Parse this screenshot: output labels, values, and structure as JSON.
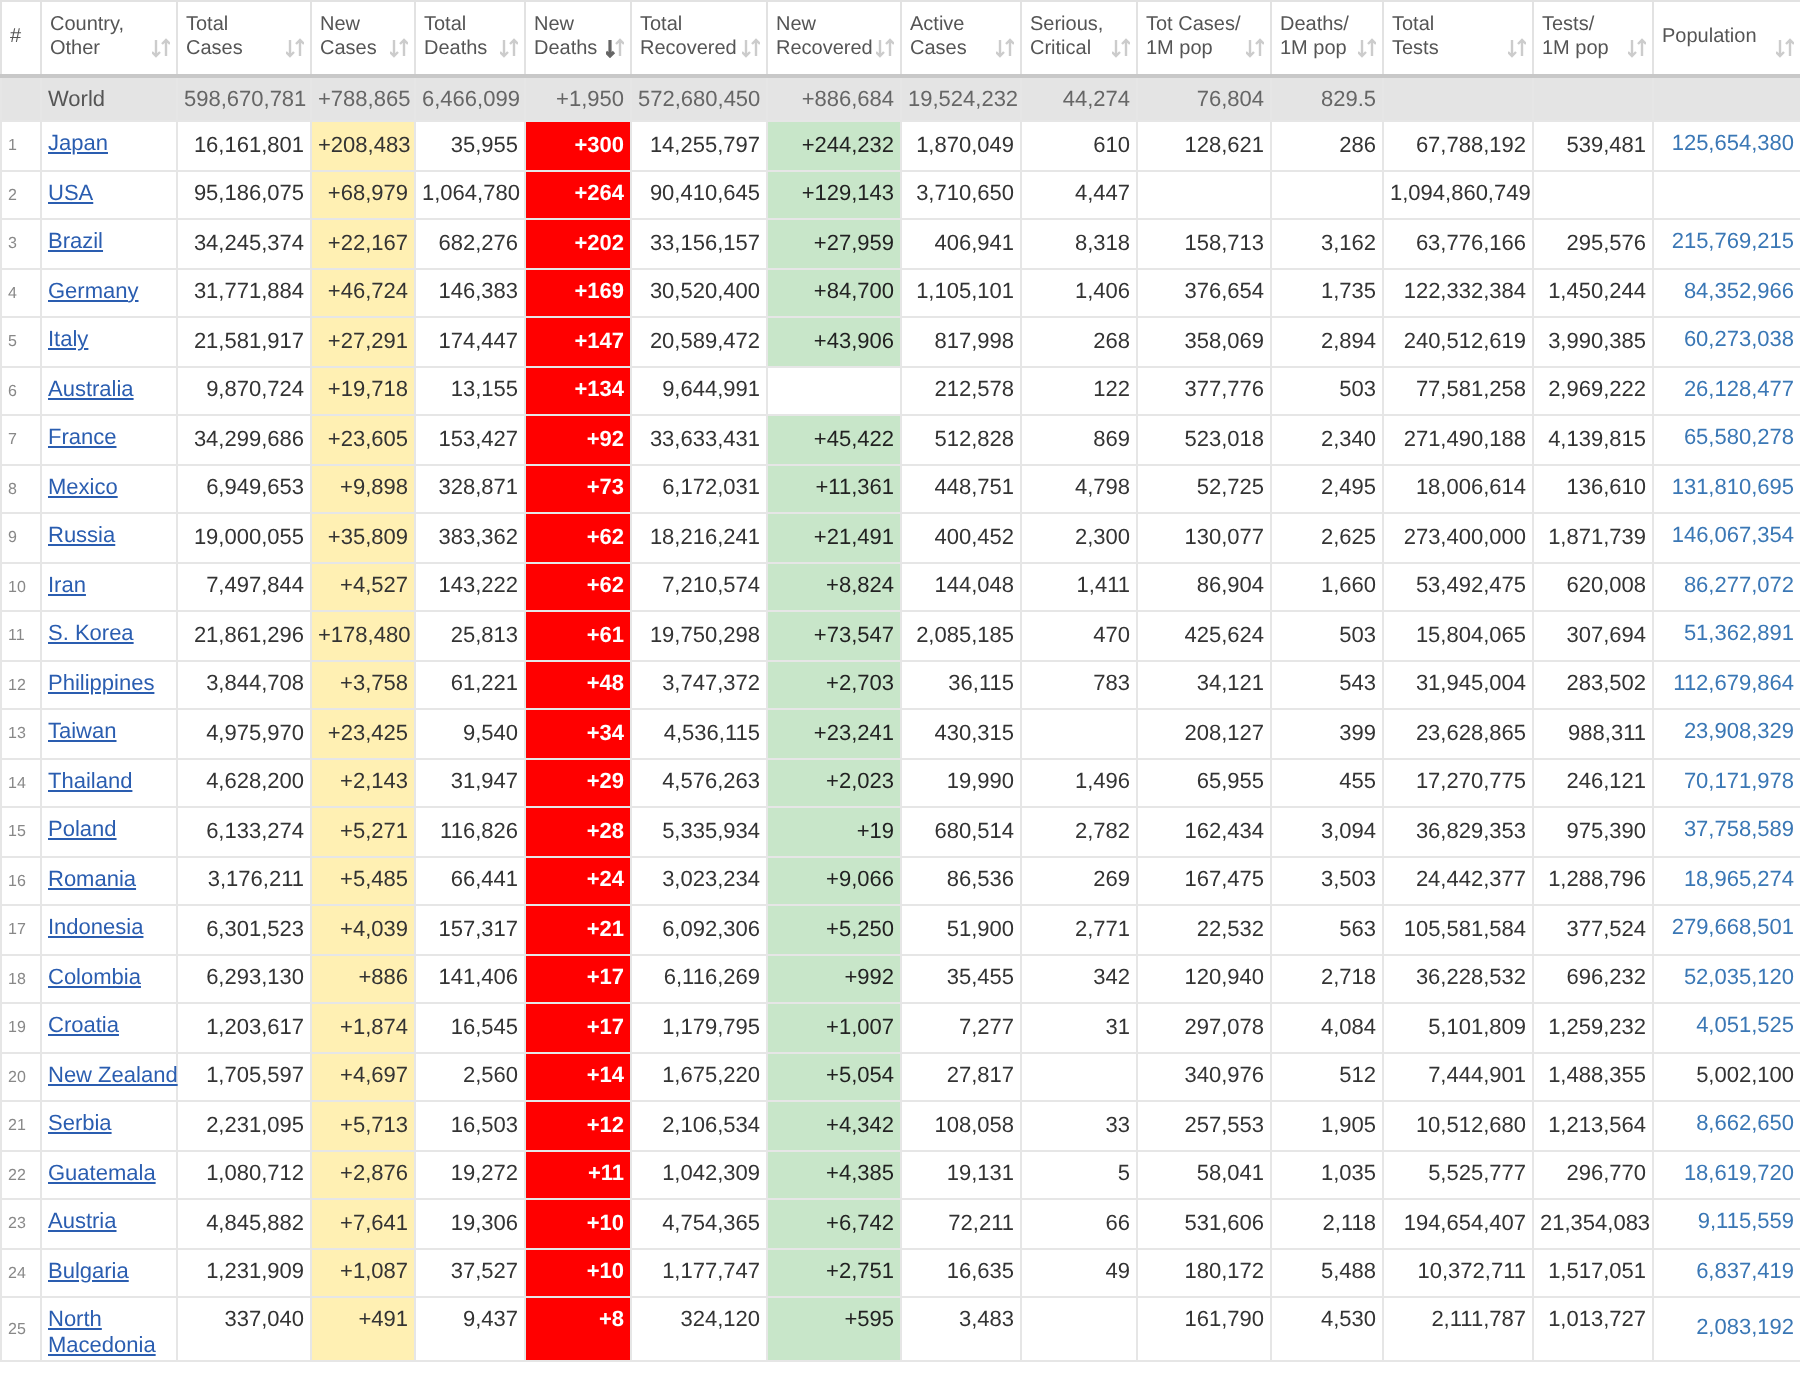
{
  "table": {
    "columns": [
      {
        "label": "#",
        "kind": "rank",
        "sortable": false
      },
      {
        "label": "Country,\nOther",
        "kind": "country",
        "sortable": true,
        "sorted": false
      },
      {
        "label": "Total\nCases",
        "kind": "plain",
        "sortable": true,
        "sorted": false
      },
      {
        "label": "New\nCases",
        "kind": "new_cases",
        "sortable": true,
        "sorted": false
      },
      {
        "label": "Total\nDeaths",
        "kind": "plain",
        "sortable": true,
        "sorted": false
      },
      {
        "label": "New\nDeaths",
        "kind": "new_deaths",
        "sortable": true,
        "sorted": true
      },
      {
        "label": "Total\nRecovered",
        "kind": "plain",
        "sortable": true,
        "sorted": false
      },
      {
        "label": "New\nRecovered",
        "kind": "new_recovered",
        "sortable": true,
        "sorted": false
      },
      {
        "label": "Active\nCases",
        "kind": "plain",
        "sortable": true,
        "sorted": false
      },
      {
        "label": "Serious,\nCritical",
        "kind": "plain",
        "sortable": true,
        "sorted": false
      },
      {
        "label": "Tot Cases/\n1M pop",
        "kind": "plain",
        "sortable": true,
        "sorted": false
      },
      {
        "label": "Deaths/\n1M pop",
        "kind": "plain",
        "sortable": true,
        "sorted": false
      },
      {
        "label": "Total\nTests",
        "kind": "plain",
        "sortable": true,
        "sorted": false
      },
      {
        "label": "Tests/\n1M pop",
        "kind": "plain",
        "sortable": true,
        "sorted": false
      },
      {
        "label": "Population",
        "kind": "population",
        "sortable": true,
        "sorted": false
      }
    ],
    "world": {
      "country": "World",
      "total_cases": "598,670,781",
      "new_cases": "+788,865",
      "total_deaths": "6,466,099",
      "new_deaths": "+1,950",
      "total_recovered": "572,680,450",
      "new_recovered": "+886,684",
      "active": "19,524,232",
      "serious": "44,274",
      "cases_per_m": "76,804",
      "deaths_per_m": "829.5"
    },
    "rows": [
      {
        "rank": "1",
        "country": "Japan",
        "total_cases": "16,161,801",
        "new_cases": "+208,483",
        "total_deaths": "35,955",
        "new_deaths": "+300",
        "total_recovered": "14,255,797",
        "new_recovered": "+244,232",
        "active": "1,870,049",
        "serious": "610",
        "cases_per_m": "128,621",
        "deaths_per_m": "286",
        "total_tests": "67,788,192",
        "tests_per_m": "539,481",
        "population": "125,654,380",
        "population_linked": true
      },
      {
        "rank": "2",
        "country": "USA",
        "total_cases": "95,186,075",
        "new_cases": "+68,979",
        "total_deaths": "1,064,780",
        "new_deaths": "+264",
        "total_recovered": "90,410,645",
        "new_recovered": "+129,143",
        "active": "3,710,650",
        "serious": "4,447",
        "total_tests": "1,094,860,749"
      },
      {
        "rank": "3",
        "country": "Brazil",
        "total_cases": "34,245,374",
        "new_cases": "+22,167",
        "total_deaths": "682,276",
        "new_deaths": "+202",
        "total_recovered": "33,156,157",
        "new_recovered": "+27,959",
        "active": "406,941",
        "serious": "8,318",
        "cases_per_m": "158,713",
        "deaths_per_m": "3,162",
        "total_tests": "63,776,166",
        "tests_per_m": "295,576",
        "population": "215,769,215",
        "population_linked": true
      },
      {
        "rank": "4",
        "country": "Germany",
        "total_cases": "31,771,884",
        "new_cases": "+46,724",
        "total_deaths": "146,383",
        "new_deaths": "+169",
        "total_recovered": "30,520,400",
        "new_recovered": "+84,700",
        "active": "1,105,101",
        "serious": "1,406",
        "cases_per_m": "376,654",
        "deaths_per_m": "1,735",
        "total_tests": "122,332,384",
        "tests_per_m": "1,450,244",
        "population": "84,352,966",
        "population_linked": true
      },
      {
        "rank": "5",
        "country": "Italy",
        "total_cases": "21,581,917",
        "new_cases": "+27,291",
        "total_deaths": "174,447",
        "new_deaths": "+147",
        "total_recovered": "20,589,472",
        "new_recovered": "+43,906",
        "active": "817,998",
        "serious": "268",
        "cases_per_m": "358,069",
        "deaths_per_m": "2,894",
        "total_tests": "240,512,619",
        "tests_per_m": "3,990,385",
        "population": "60,273,038",
        "population_linked": true
      },
      {
        "rank": "6",
        "country": "Australia",
        "total_cases": "9,870,724",
        "new_cases": "+19,718",
        "total_deaths": "13,155",
        "new_deaths": "+134",
        "total_recovered": "9,644,991",
        "active": "212,578",
        "serious": "122",
        "cases_per_m": "377,776",
        "deaths_per_m": "503",
        "total_tests": "77,581,258",
        "tests_per_m": "2,969,222",
        "population": "26,128,477",
        "population_linked": true
      },
      {
        "rank": "7",
        "country": "France",
        "total_cases": "34,299,686",
        "new_cases": "+23,605",
        "total_deaths": "153,427",
        "new_deaths": "+92",
        "total_recovered": "33,633,431",
        "new_recovered": "+45,422",
        "active": "512,828",
        "serious": "869",
        "cases_per_m": "523,018",
        "deaths_per_m": "2,340",
        "total_tests": "271,490,188",
        "tests_per_m": "4,139,815",
        "population": "65,580,278",
        "population_linked": true
      },
      {
        "rank": "8",
        "country": "Mexico",
        "total_cases": "6,949,653",
        "new_cases": "+9,898",
        "total_deaths": "328,871",
        "new_deaths": "+73",
        "total_recovered": "6,172,031",
        "new_recovered": "+11,361",
        "active": "448,751",
        "serious": "4,798",
        "cases_per_m": "52,725",
        "deaths_per_m": "2,495",
        "total_tests": "18,006,614",
        "tests_per_m": "136,610",
        "population": "131,810,695",
        "population_linked": true
      },
      {
        "rank": "9",
        "country": "Russia",
        "total_cases": "19,000,055",
        "new_cases": "+35,809",
        "total_deaths": "383,362",
        "new_deaths": "+62",
        "total_recovered": "18,216,241",
        "new_recovered": "+21,491",
        "active": "400,452",
        "serious": "2,300",
        "cases_per_m": "130,077",
        "deaths_per_m": "2,625",
        "total_tests": "273,400,000",
        "tests_per_m": "1,871,739",
        "population": "146,067,354",
        "population_linked": true
      },
      {
        "rank": "10",
        "country": "Iran",
        "total_cases": "7,497,844",
        "new_cases": "+4,527",
        "total_deaths": "143,222",
        "new_deaths": "+62",
        "total_recovered": "7,210,574",
        "new_recovered": "+8,824",
        "active": "144,048",
        "serious": "1,411",
        "cases_per_m": "86,904",
        "deaths_per_m": "1,660",
        "total_tests": "53,492,475",
        "tests_per_m": "620,008",
        "population": "86,277,072",
        "population_linked": true
      },
      {
        "rank": "11",
        "country": "S. Korea",
        "total_cases": "21,861,296",
        "new_cases": "+178,480",
        "total_deaths": "25,813",
        "new_deaths": "+61",
        "total_recovered": "19,750,298",
        "new_recovered": "+73,547",
        "active": "2,085,185",
        "serious": "470",
        "cases_per_m": "425,624",
        "deaths_per_m": "503",
        "total_tests": "15,804,065",
        "tests_per_m": "307,694",
        "population": "51,362,891",
        "population_linked": true
      },
      {
        "rank": "12",
        "country": "Philippines",
        "total_cases": "3,844,708",
        "new_cases": "+3,758",
        "total_deaths": "61,221",
        "new_deaths": "+48",
        "total_recovered": "3,747,372",
        "new_recovered": "+2,703",
        "active": "36,115",
        "serious": "783",
        "cases_per_m": "34,121",
        "deaths_per_m": "543",
        "total_tests": "31,945,004",
        "tests_per_m": "283,502",
        "population": "112,679,864",
        "population_linked": true
      },
      {
        "rank": "13",
        "country": "Taiwan",
        "total_cases": "4,975,970",
        "new_cases": "+23,425",
        "total_deaths": "9,540",
        "new_deaths": "+34",
        "total_recovered": "4,536,115",
        "new_recovered": "+23,241",
        "active": "430,315",
        "cases_per_m": "208,127",
        "deaths_per_m": "399",
        "total_tests": "23,628,865",
        "tests_per_m": "988,311",
        "population": "23,908,329",
        "population_linked": true
      },
      {
        "rank": "14",
        "country": "Thailand",
        "total_cases": "4,628,200",
        "new_cases": "+2,143",
        "total_deaths": "31,947",
        "new_deaths": "+29",
        "total_recovered": "4,576,263",
        "new_recovered": "+2,023",
        "active": "19,990",
        "serious": "1,496",
        "cases_per_m": "65,955",
        "deaths_per_m": "455",
        "total_tests": "17,270,775",
        "tests_per_m": "246,121",
        "population": "70,171,978",
        "population_linked": true
      },
      {
        "rank": "15",
        "country": "Poland",
        "total_cases": "6,133,274",
        "new_cases": "+5,271",
        "total_deaths": "116,826",
        "new_deaths": "+28",
        "total_recovered": "5,335,934",
        "new_recovered": "+19",
        "active": "680,514",
        "serious": "2,782",
        "cases_per_m": "162,434",
        "deaths_per_m": "3,094",
        "total_tests": "36,829,353",
        "tests_per_m": "975,390",
        "population": "37,758,589",
        "population_linked": true
      },
      {
        "rank": "16",
        "country": "Romania",
        "total_cases": "3,176,211",
        "new_cases": "+5,485",
        "total_deaths": "66,441",
        "new_deaths": "+24",
        "total_recovered": "3,023,234",
        "new_recovered": "+9,066",
        "active": "86,536",
        "serious": "269",
        "cases_per_m": "167,475",
        "deaths_per_m": "3,503",
        "total_tests": "24,442,377",
        "tests_per_m": "1,288,796",
        "population": "18,965,274",
        "population_linked": true
      },
      {
        "rank": "17",
        "country": "Indonesia",
        "total_cases": "6,301,523",
        "new_cases": "+4,039",
        "total_deaths": "157,317",
        "new_deaths": "+21",
        "total_recovered": "6,092,306",
        "new_recovered": "+5,250",
        "active": "51,900",
        "serious": "2,771",
        "cases_per_m": "22,532",
        "deaths_per_m": "563",
        "total_tests": "105,581,584",
        "tests_per_m": "377,524",
        "population": "279,668,501",
        "population_linked": true
      },
      {
        "rank": "18",
        "country": "Colombia",
        "total_cases": "6,293,130",
        "new_cases": "+886",
        "total_deaths": "141,406",
        "new_deaths": "+17",
        "total_recovered": "6,116,269",
        "new_recovered": "+992",
        "active": "35,455",
        "serious": "342",
        "cases_per_m": "120,940",
        "deaths_per_m": "2,718",
        "total_tests": "36,228,532",
        "tests_per_m": "696,232",
        "population": "52,035,120",
        "population_linked": true
      },
      {
        "rank": "19",
        "country": "Croatia",
        "total_cases": "1,203,617",
        "new_cases": "+1,874",
        "total_deaths": "16,545",
        "new_deaths": "+17",
        "total_recovered": "1,179,795",
        "new_recovered": "+1,007",
        "active": "7,277",
        "serious": "31",
        "cases_per_m": "297,078",
        "deaths_per_m": "4,084",
        "total_tests": "5,101,809",
        "tests_per_m": "1,259,232",
        "population": "4,051,525",
        "population_linked": true
      },
      {
        "rank": "20",
        "country": "New Zealand",
        "total_cases": "1,705,597",
        "new_cases": "+4,697",
        "total_deaths": "2,560",
        "new_deaths": "+14",
        "total_recovered": "1,675,220",
        "new_recovered": "+5,054",
        "active": "27,817",
        "cases_per_m": "340,976",
        "deaths_per_m": "512",
        "total_tests": "7,444,901",
        "tests_per_m": "1,488,355",
        "population": "5,002,100",
        "population_linked": false
      },
      {
        "rank": "21",
        "country": "Serbia",
        "total_cases": "2,231,095",
        "new_cases": "+5,713",
        "total_deaths": "16,503",
        "new_deaths": "+12",
        "total_recovered": "2,106,534",
        "new_recovered": "+4,342",
        "active": "108,058",
        "serious": "33",
        "cases_per_m": "257,553",
        "deaths_per_m": "1,905",
        "total_tests": "10,512,680",
        "tests_per_m": "1,213,564",
        "population": "8,662,650",
        "population_linked": true
      },
      {
        "rank": "22",
        "country": "Guatemala",
        "total_cases": "1,080,712",
        "new_cases": "+2,876",
        "total_deaths": "19,272",
        "new_deaths": "+11",
        "total_recovered": "1,042,309",
        "new_recovered": "+4,385",
        "active": "19,131",
        "serious": "5",
        "cases_per_m": "58,041",
        "deaths_per_m": "1,035",
        "total_tests": "5,525,777",
        "tests_per_m": "296,770",
        "population": "18,619,720",
        "population_linked": true
      },
      {
        "rank": "23",
        "country": "Austria",
        "total_cases": "4,845,882",
        "new_cases": "+7,641",
        "total_deaths": "19,306",
        "new_deaths": "+10",
        "total_recovered": "4,754,365",
        "new_recovered": "+6,742",
        "active": "72,211",
        "serious": "66",
        "cases_per_m": "531,606",
        "deaths_per_m": "2,118",
        "total_tests": "194,654,407",
        "tests_per_m": "21,354,083",
        "population": "9,115,559",
        "population_linked": true
      },
      {
        "rank": "24",
        "country": "Bulgaria",
        "total_cases": "1,231,909",
        "new_cases": "+1,087",
        "total_deaths": "37,527",
        "new_deaths": "+10",
        "total_recovered": "1,177,747",
        "new_recovered": "+2,751",
        "active": "16,635",
        "serious": "49",
        "cases_per_m": "180,172",
        "deaths_per_m": "5,488",
        "total_tests": "10,372,711",
        "tests_per_m": "1,517,051",
        "population": "6,837,419",
        "population_linked": true
      },
      {
        "rank": "25",
        "country": "North Macedonia",
        "total_cases": "337,040",
        "new_cases": "+491",
        "total_deaths": "9,437",
        "new_deaths": "+8",
        "total_recovered": "324,120",
        "new_recovered": "+595",
        "active": "3,483",
        "cases_per_m": "161,790",
        "deaths_per_m": "4,530",
        "total_tests": "2,111,787",
        "tests_per_m": "1,013,727",
        "population": "2,083,192",
        "population_linked": true
      }
    ]
  }
}
